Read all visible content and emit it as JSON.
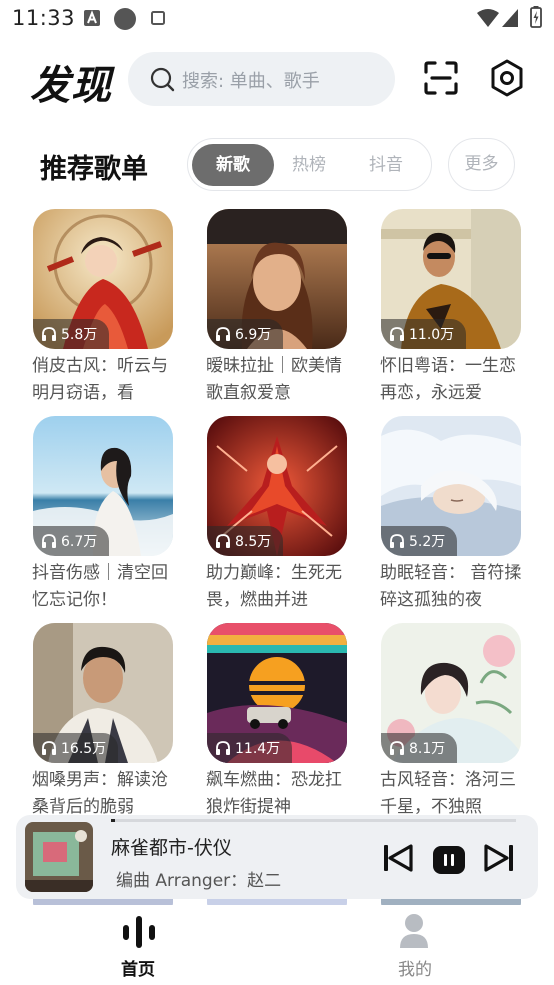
{
  "status": {
    "time": "11:33"
  },
  "header": {
    "title": "发现",
    "search_placeholder": "搜索: 单曲、歌手"
  },
  "section": {
    "title": "推荐歌单",
    "tabs": [
      {
        "label": "新歌",
        "active": true
      },
      {
        "label": "热榜",
        "active": false
      },
      {
        "label": "抖音",
        "active": false
      }
    ],
    "more_label": "更多"
  },
  "playlists": [
    {
      "title": "俏皮古风：听云与明月窃语，看",
      "plays": "5.8万"
    },
    {
      "title": "暧昧拉扯｜欧美情歌直叙爱意",
      "plays": "6.9万"
    },
    {
      "title": "怀旧粤语：一生恋再恋，永远爱",
      "plays": "11.0万"
    },
    {
      "title": "抖音伤感｜清空回忆忘记你！",
      "plays": "6.7万"
    },
    {
      "title": "助力巅峰：生死无畏，燃曲并进",
      "plays": "8.5万"
    },
    {
      "title": "助眠轻音： 音符揉碎这孤独的夜",
      "plays": "5.2万"
    },
    {
      "title": "烟嗓男声：解读沧桑背后的脆弱",
      "plays": "16.5万"
    },
    {
      "title": "飙车燃曲：恐龙扛狼炸街提神",
      "plays": "11.4万"
    },
    {
      "title": "古风轻音：洛河三千星，不独照",
      "plays": "8.1万"
    }
  ],
  "player": {
    "title": "麻雀都市-伏仪",
    "artist": "编曲 Arranger：赵二",
    "progress": 0.01
  },
  "nav": {
    "items": [
      {
        "label": "首页",
        "active": true
      },
      {
        "label": "我的",
        "active": false
      }
    ]
  }
}
